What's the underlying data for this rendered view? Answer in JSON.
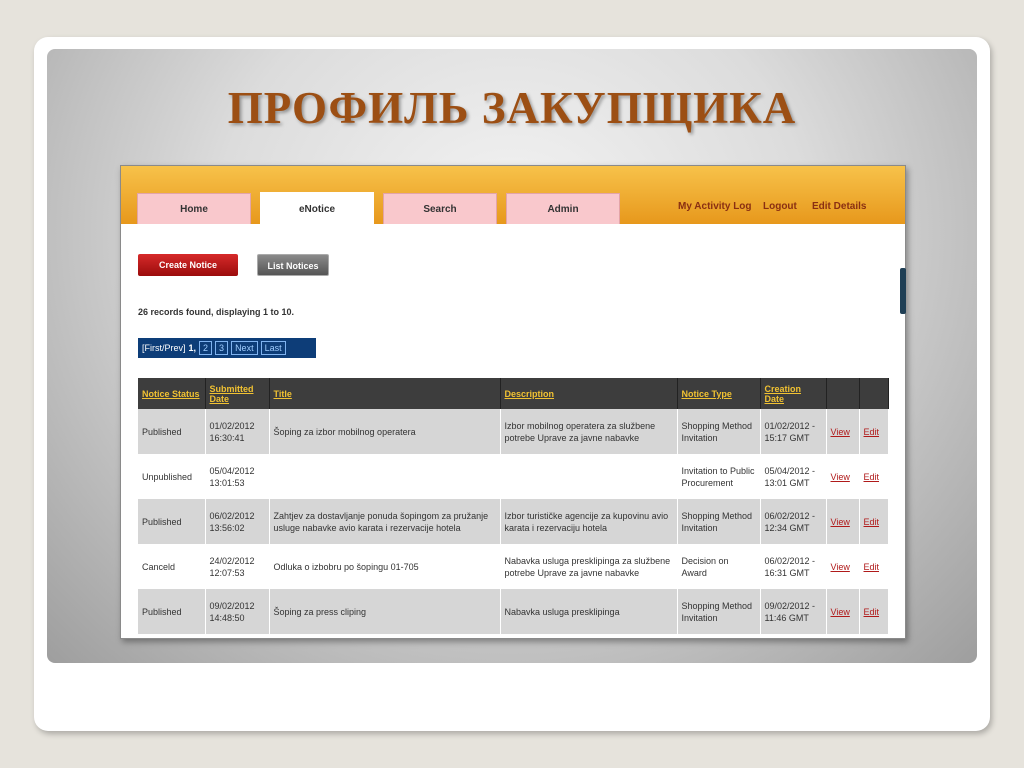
{
  "slide": {
    "title": "ПРОФИЛЬ ЗАКУПЩИКА"
  },
  "tabs": [
    {
      "label": "Home"
    },
    {
      "label": "eNotice"
    },
    {
      "label": "Search"
    },
    {
      "label": "Admin"
    }
  ],
  "top_links": {
    "activity_log": "My Activity Log",
    "logout": "Logout",
    "edit_details": "Edit Details"
  },
  "buttons": {
    "create_notice": "Create Notice",
    "list_notices": "List Notices"
  },
  "records_text": "26 records found, displaying 1 to 10.",
  "pager": {
    "first_prev": "[First/Prev]",
    "current": "1,",
    "pages": [
      "2",
      "3"
    ],
    "next": "Next",
    "last": "Last"
  },
  "table": {
    "headers": [
      "Notice Status",
      "Submitted Date",
      "Title",
      "Description",
      "Notice Type",
      "Creation Date",
      "",
      ""
    ],
    "rows": [
      {
        "status": "Published",
        "submitted": "01/02/2012 16:30:41",
        "title": "Šoping za izbor mobilnog operatera",
        "description": "Izbor mobilnog operatera za službene potrebe Uprave za javne nabavke",
        "type": "Shopping Method Invitation",
        "created": "01/02/2012 - 15:17 GMT",
        "view": "View",
        "edit": "Edit"
      },
      {
        "status": "Unpublished",
        "submitted": "05/04/2012 13:01:53",
        "title": "",
        "description": "",
        "type": "Invitation to Public Procurement",
        "created": "05/04/2012 - 13:01 GMT",
        "view": "View",
        "edit": "Edit"
      },
      {
        "status": "Published",
        "submitted": "06/02/2012 13:56:02",
        "title": "Zahtjev za dostavljanje ponuda šopingom za pružanje usluge nabavke avio karata i rezervacije hotela",
        "description": "Izbor turističke agencije za kupovinu avio karata i rezervaciju hotela",
        "type": "Shopping Method Invitation",
        "created": "06/02/2012 - 12:34 GMT",
        "view": "View",
        "edit": "Edit"
      },
      {
        "status": "Canceld",
        "submitted": "24/02/2012 12:07:53",
        "title": "Odluka o izbobru po šopingu 01-705",
        "description": "Nabavka usluga presklipinga za službene potrebe Uprave za javne nabavke",
        "type": "Decision on Award",
        "created": "06/02/2012 - 16:31 GMT",
        "view": "View",
        "edit": "Edit"
      },
      {
        "status": "Published",
        "submitted": "09/02/2012 14:48:50",
        "title": "Šoping za press cliping",
        "description": "Nabavka usluga presklipinga",
        "type": "Shopping Method Invitation",
        "created": "09/02/2012 - 11:46 GMT",
        "view": "View",
        "edit": "Edit"
      }
    ]
  }
}
